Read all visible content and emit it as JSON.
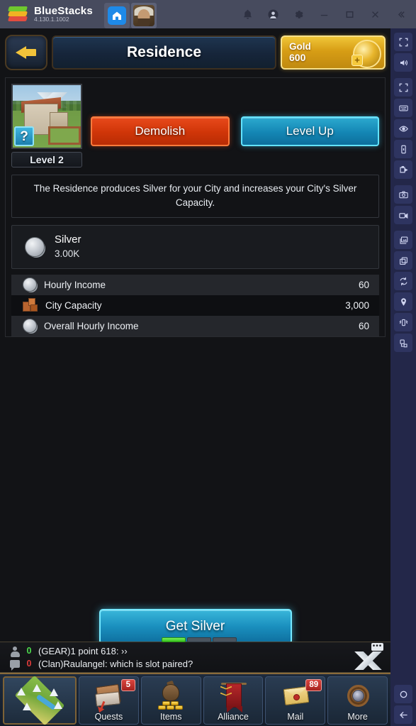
{
  "titlebar": {
    "brand": "BlueStacks",
    "version": "4.130.1.1002",
    "tabs": [
      {
        "name": "home-tab",
        "icon": "home-icon"
      },
      {
        "name": "game-tab",
        "icon": "avatar-icon"
      }
    ],
    "controls": [
      {
        "name": "notifications-button",
        "icon": "bell-icon"
      },
      {
        "name": "account-button",
        "icon": "user-circle-icon"
      },
      {
        "name": "settings-button",
        "icon": "gear-icon"
      },
      {
        "name": "minimize-button",
        "icon": "minimize-icon"
      },
      {
        "name": "maximize-button",
        "icon": "maximize-icon"
      },
      {
        "name": "close-button",
        "icon": "close-icon"
      },
      {
        "name": "collapse-button",
        "icon": "chevron-double-left-icon"
      }
    ]
  },
  "game_header": {
    "back_label": "back-arrow",
    "title": "Residence",
    "gold_label": "Gold",
    "gold_value": "600"
  },
  "building": {
    "level_label": "Level 2",
    "info_badge": "?",
    "description": "The Residence produces Silver for your City and increases your City's Silver Capacity.",
    "demolish_label": "Demolish",
    "levelup_label": "Level Up"
  },
  "resource": {
    "name": "Silver",
    "amount": "3.00K"
  },
  "stats": [
    {
      "label": "Hourly Income",
      "value": "60",
      "icon": "silver-coin-icon"
    },
    {
      "label": "City Capacity",
      "value": "3,000",
      "icon": "crate-icon"
    },
    {
      "label": "Overall Hourly Income",
      "value": "60",
      "icon": "silver-coin-icon"
    }
  ],
  "actions": {
    "get_silver_label": "Get Silver"
  },
  "chat": {
    "lines": [
      {
        "count": "0",
        "count_color": "#4ddc4d",
        "text": "(GEAR)1 point 618:  ››"
      },
      {
        "count": "0",
        "count_color": "#e03b3b",
        "text": "(Clan)Raulangel: which is slot paired?"
      }
    ],
    "progress_segments": [
      true,
      false,
      false
    ]
  },
  "nav": [
    {
      "name": "nav-map",
      "label": "",
      "badge": ""
    },
    {
      "name": "nav-quests",
      "label": "Quests",
      "badge": "5"
    },
    {
      "name": "nav-items",
      "label": "Items",
      "badge": ""
    },
    {
      "name": "nav-alliance",
      "label": "Alliance",
      "badge": ""
    },
    {
      "name": "nav-mail",
      "label": "Mail",
      "badge": "89"
    },
    {
      "name": "nav-more",
      "label": "More",
      "badge": ""
    }
  ],
  "sidebar": [
    {
      "name": "fullscreen-icon"
    },
    {
      "name": "volume-icon"
    },
    {
      "name": "fit-to-screen-icon"
    },
    {
      "name": "keyboard-icon"
    },
    {
      "name": "eye-icon"
    },
    {
      "name": "rotate-device-icon"
    },
    {
      "name": "macro-icon"
    },
    {
      "name": "camera-icon"
    },
    {
      "name": "video-icon"
    },
    {
      "name": "media-manager-icon"
    },
    {
      "name": "multi-instance-icon"
    },
    {
      "name": "sync-icon"
    },
    {
      "name": "location-icon"
    },
    {
      "name": "shake-icon"
    },
    {
      "name": "install-apk-icon"
    },
    {
      "name": "home-circle-icon"
    },
    {
      "name": "back-arrow-icon"
    }
  ],
  "colors": {
    "accent_cyan": "#2ba9cf",
    "accent_red": "#cf3508",
    "gold": "#e8b62c",
    "titlebar": "#474b5e",
    "sidebar": "#232749"
  }
}
